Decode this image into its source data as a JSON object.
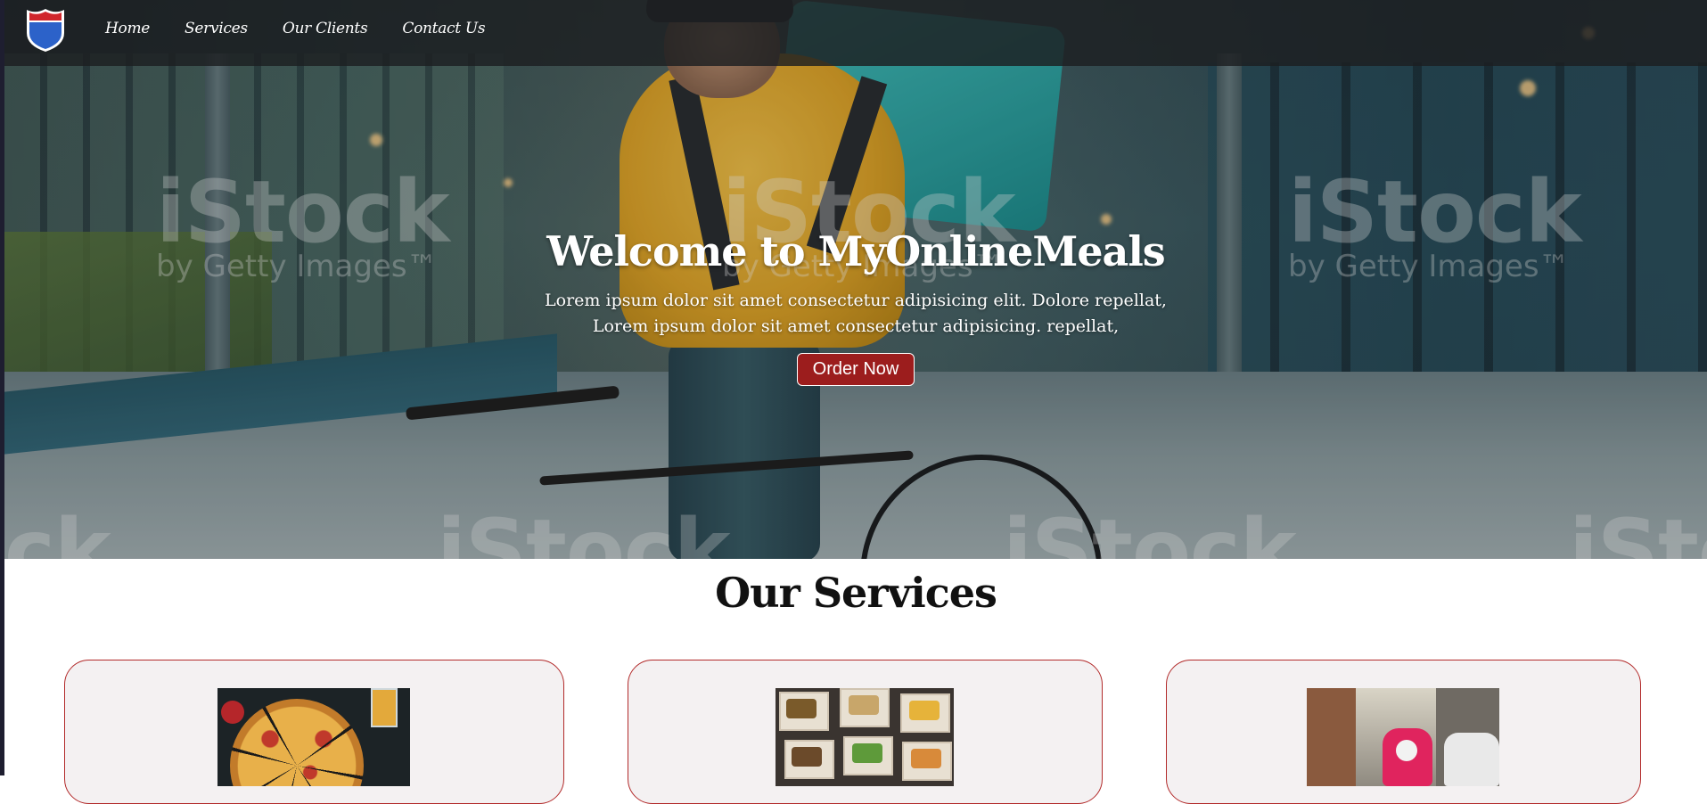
{
  "nav": {
    "items": [
      {
        "label": "Home"
      },
      {
        "label": "Services"
      },
      {
        "label": "Our Clients"
      },
      {
        "label": "Contact Us"
      }
    ]
  },
  "hero": {
    "watermark_brand": "iStock",
    "watermark_sub": "by Getty Images™",
    "title": "Welcome to MyOnlineMeals",
    "line1": "Lorem ipsum dolor sit amet consectetur adipisicing elit. Dolore repellat,",
    "line2": "Lorem ipsum dolor sit amet consectetur adipisicing. repellat,",
    "button_label": "Order Now"
  },
  "services": {
    "title": "Our Services",
    "cards": [
      {
        "image_icon": "pizza-image"
      },
      {
        "image_icon": "takeaway-boxes-image"
      },
      {
        "image_icon": "delivery-rider-image"
      }
    ]
  },
  "colors": {
    "accent": "#9c1d1d",
    "card_border": "#b22a2a",
    "nav_bg": "#1c1e21",
    "card_bg": "#f4f1f2"
  }
}
